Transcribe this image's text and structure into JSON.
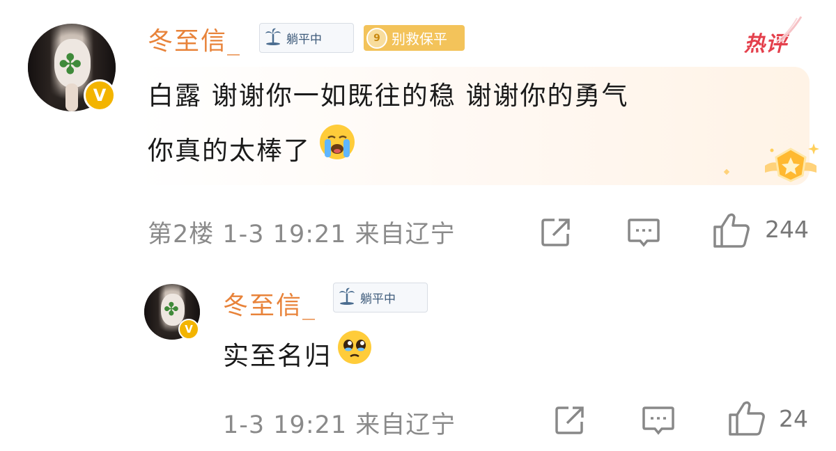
{
  "comment": {
    "username": "冬至信_",
    "status_tag": "躺平中",
    "rescue_level": "9",
    "rescue_tag": "别救保平",
    "hot_badge": "热评",
    "text_line1": "白露 谢谢你一如既往的稳 谢谢你的勇气",
    "text_line2": "你真的太棒了",
    "meta": "第2楼 1-3 19:21 来自辽宁",
    "like_count": "244"
  },
  "reply": {
    "username": "冬至信_",
    "status_tag": "躺平中",
    "text": "实至名归",
    "meta": "1-3 19:21 来自辽宁",
    "like_count": "24"
  },
  "icons": {
    "share": "share-icon",
    "comment": "comment-icon",
    "like": "thumbs-up-icon",
    "crying_emoji": "loudly-crying-face",
    "pleading_emoji": "pleading-face",
    "verified": "v-badge"
  }
}
